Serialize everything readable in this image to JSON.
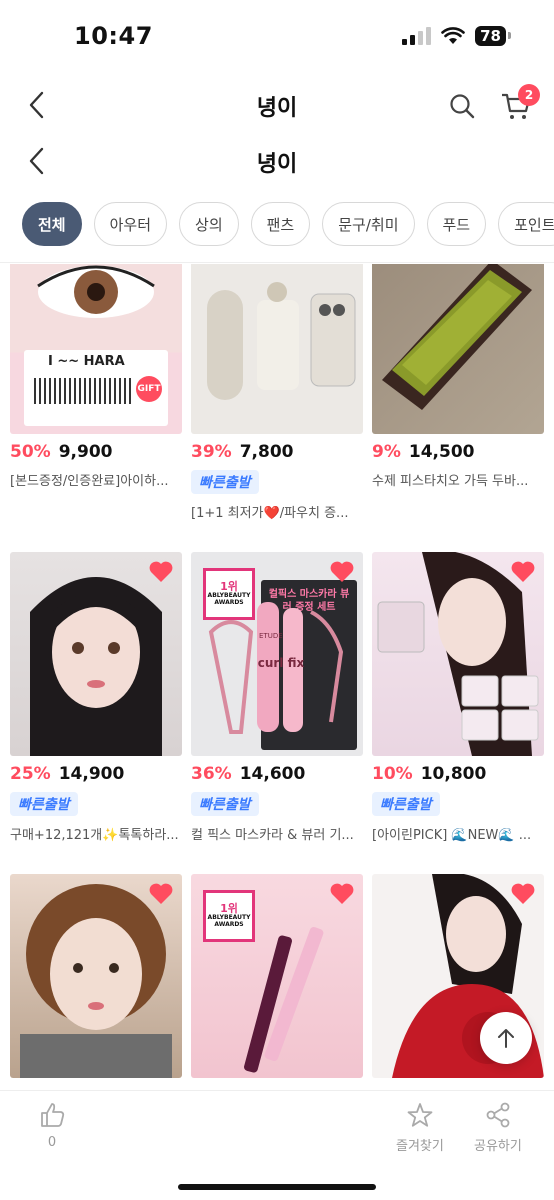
{
  "status": {
    "time": "10:47",
    "battery": "78"
  },
  "header": {
    "title": "녕이",
    "cart_count": "2"
  },
  "header_secondary": {
    "title": "녕이"
  },
  "categories": [
    "전체",
    "아우터",
    "상의",
    "팬츠",
    "문구/취미",
    "푸드",
    "포인트"
  ],
  "products": [
    {
      "discount": "50%",
      "price": "9,900",
      "fast": "",
      "name": "[본드증정/인증완료]아이하...",
      "thumb_text": "I ~~ HARA",
      "thumb_tag": "GIFT"
    },
    {
      "discount": "39%",
      "price": "7,800",
      "fast": "빠른출발",
      "name": "[1+1 최저가❤️/파우치 증..."
    },
    {
      "discount": "9%",
      "price": "14,500",
      "fast": "",
      "name": "수제 피스타치오 가득 두바..."
    },
    {
      "discount": "25%",
      "price": "14,900",
      "fast": "빠른출발",
      "name": "구매+12,121개✨톡톡하라..."
    },
    {
      "discount": "36%",
      "price": "14,600",
      "fast": "빠른출발",
      "name": "컬 픽스 마스카라 & 뷰러 기...",
      "awards_title": "ABLYBEAUTY AWARDS",
      "awards_rank": "1위",
      "set_label": "컬픽스 마스카라 뷰러 증정 세트",
      "brand": "ETUDE",
      "product_text": "curl fix"
    },
    {
      "discount": "10%",
      "price": "10,800",
      "fast": "빠른출발",
      "name": "[아이린PICK] 🌊NEW🌊 ..."
    },
    {
      "discount": "",
      "price": "",
      "fast": "",
      "name": ""
    },
    {
      "discount": "",
      "price": "",
      "fast": "",
      "name": "",
      "awards_title": "ABLYBEAUTY AWARDS",
      "awards_rank": "1위"
    },
    {
      "discount": "",
      "price": "",
      "fast": "",
      "name": ""
    }
  ],
  "bottom_bar": {
    "like_count": "0",
    "favorite_label": "즐겨찾기",
    "share_label": "공유하기"
  },
  "colors": {
    "accent": "#ff4c5f",
    "chip_active": "#4a5a74",
    "fast_blue": "#3b7bff"
  }
}
